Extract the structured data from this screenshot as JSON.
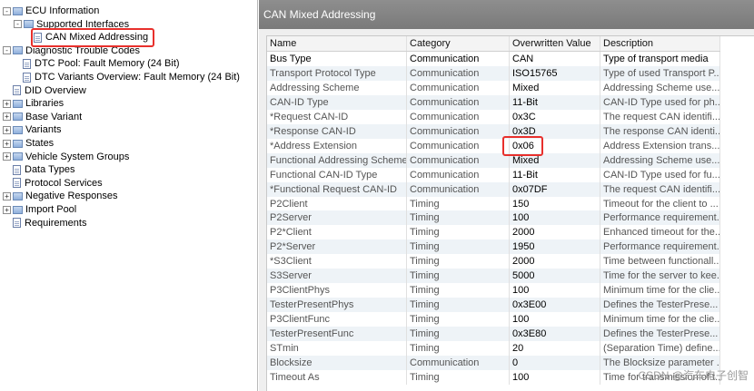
{
  "tree": [
    {
      "label": "ECU Information",
      "indent": 0,
      "expander": "-",
      "icon": "folder"
    },
    {
      "label": "Supported Interfaces",
      "indent": 1,
      "expander": "-",
      "icon": "folder"
    },
    {
      "label": "CAN Mixed Addressing",
      "indent": 2,
      "expander": "",
      "icon": "doc"
    },
    {
      "label": "Diagnostic Trouble Codes",
      "indent": 0,
      "expander": "-",
      "icon": "folder"
    },
    {
      "label": "DTC Pool: Fault Memory (24 Bit)",
      "indent": 1,
      "expander": "",
      "icon": "doc"
    },
    {
      "label": "DTC Variants Overview: Fault Memory (24 Bit)",
      "indent": 1,
      "expander": "",
      "icon": "doc"
    },
    {
      "label": "DID Overview",
      "indent": 0,
      "expander": "",
      "icon": "doc"
    },
    {
      "label": "Libraries",
      "indent": 0,
      "expander": "+",
      "icon": "folder"
    },
    {
      "label": "Base Variant",
      "indent": 0,
      "expander": "+",
      "icon": "folder"
    },
    {
      "label": "Variants",
      "indent": 0,
      "expander": "+",
      "icon": "folder"
    },
    {
      "label": "States",
      "indent": 0,
      "expander": "+",
      "icon": "folder"
    },
    {
      "label": "Vehicle System Groups",
      "indent": 0,
      "expander": "+",
      "icon": "folder"
    },
    {
      "label": "Data Types",
      "indent": 0,
      "expander": "",
      "icon": "doc"
    },
    {
      "label": "Protocol Services",
      "indent": 0,
      "expander": "",
      "icon": "doc"
    },
    {
      "label": "Negative Responses",
      "indent": 0,
      "expander": "+",
      "icon": "folder"
    },
    {
      "label": "Import Pool",
      "indent": 0,
      "expander": "+",
      "icon": "folder"
    },
    {
      "label": "Requirements",
      "indent": 0,
      "expander": "",
      "icon": "doc"
    }
  ],
  "panel_title": "CAN Mixed Addressing",
  "columns": [
    "Name",
    "Category",
    "Overwritten Value",
    "Description"
  ],
  "rows": [
    [
      "Bus Type",
      "Communication",
      "CAN",
      "Type of transport media"
    ],
    [
      "Transport Protocol Type",
      "Communication",
      "ISO15765",
      "Type of used Transport P..."
    ],
    [
      "Addressing Scheme",
      "Communication",
      "Mixed",
      "Addressing Scheme use..."
    ],
    [
      "CAN-ID Type",
      "Communication",
      "11-Bit",
      "CAN-ID Type used for ph..."
    ],
    [
      "*Request CAN-ID",
      "Communication",
      "0x3C",
      "The request CAN identifi..."
    ],
    [
      "*Response CAN-ID",
      "Communication",
      "0x3D",
      "The response CAN identi..."
    ],
    [
      "*Address Extension",
      "Communication",
      "0x06",
      "Address Extension trans..."
    ],
    [
      "Functional Addressing Scheme",
      "Communication",
      "Mixed",
      "Addressing Scheme use..."
    ],
    [
      "Functional CAN-ID Type",
      "Communication",
      "11-Bit",
      "CAN-ID Type used for fu..."
    ],
    [
      "*Functional Request CAN-ID",
      "Communication",
      "0x07DF",
      "The request CAN identifi..."
    ],
    [
      "P2Client",
      "Timing",
      "150",
      "Timeout for the client to ..."
    ],
    [
      "P2Server",
      "Timing",
      "100",
      "Performance requirement..."
    ],
    [
      "P2*Client",
      "Timing",
      "2000",
      "Enhanced timeout for the..."
    ],
    [
      "P2*Server",
      "Timing",
      "1950",
      "Performance requirement..."
    ],
    [
      "*S3Client",
      "Timing",
      "2000",
      "Time between functionall..."
    ],
    [
      "S3Server",
      "Timing",
      "5000",
      "Time for the server to kee..."
    ],
    [
      "P3ClientPhys",
      "Timing",
      "100",
      "Minimum time for the clie..."
    ],
    [
      "TesterPresentPhys",
      "Timing",
      "0x3E00",
      "Defines the TesterPrese..."
    ],
    [
      "P3ClientFunc",
      "Timing",
      "100",
      "Minimum time for the clie..."
    ],
    [
      "TesterPresentFunc",
      "Timing",
      "0x3E80",
      "Defines the TesterPrese..."
    ],
    [
      "STmin",
      "Timing",
      "20",
      "(Separation Time) define..."
    ],
    [
      "Blocksize",
      "Communication",
      "0",
      "The Blocksize parameter ..."
    ],
    [
      "Timeout As",
      "Timing",
      "100",
      "Time for transmission of t..."
    ]
  ],
  "watermark": "CSDN @汽车电子创智",
  "colors": {
    "highlight": "#e8302c",
    "header_bg": "#858585",
    "stripe": "#eef3f7"
  }
}
